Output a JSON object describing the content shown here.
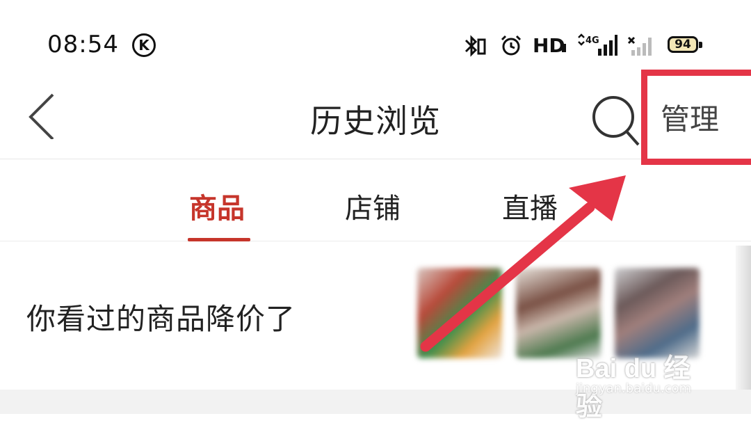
{
  "status_bar": {
    "time": "08:54",
    "k_label": "K",
    "hd_label": "HD",
    "battery": "94",
    "icons": [
      "bluetooth-icon",
      "alarm-icon",
      "signal-4g-icon",
      "signal-off-icon"
    ]
  },
  "nav": {
    "title": "历史浏览",
    "manage_label": "管理",
    "icons": [
      "back-icon",
      "search-icon"
    ]
  },
  "tabs": [
    {
      "label": "商品",
      "active": true
    },
    {
      "label": "店铺",
      "active": false
    },
    {
      "label": "直播",
      "active": false
    }
  ],
  "promo": {
    "text": "你看过的商品降价了"
  },
  "watermark": {
    "logo": "Bai du 经验",
    "url": "jingyan.baidu.com"
  },
  "colors": {
    "accent": "#c6352b",
    "annotation": "#e43547"
  }
}
